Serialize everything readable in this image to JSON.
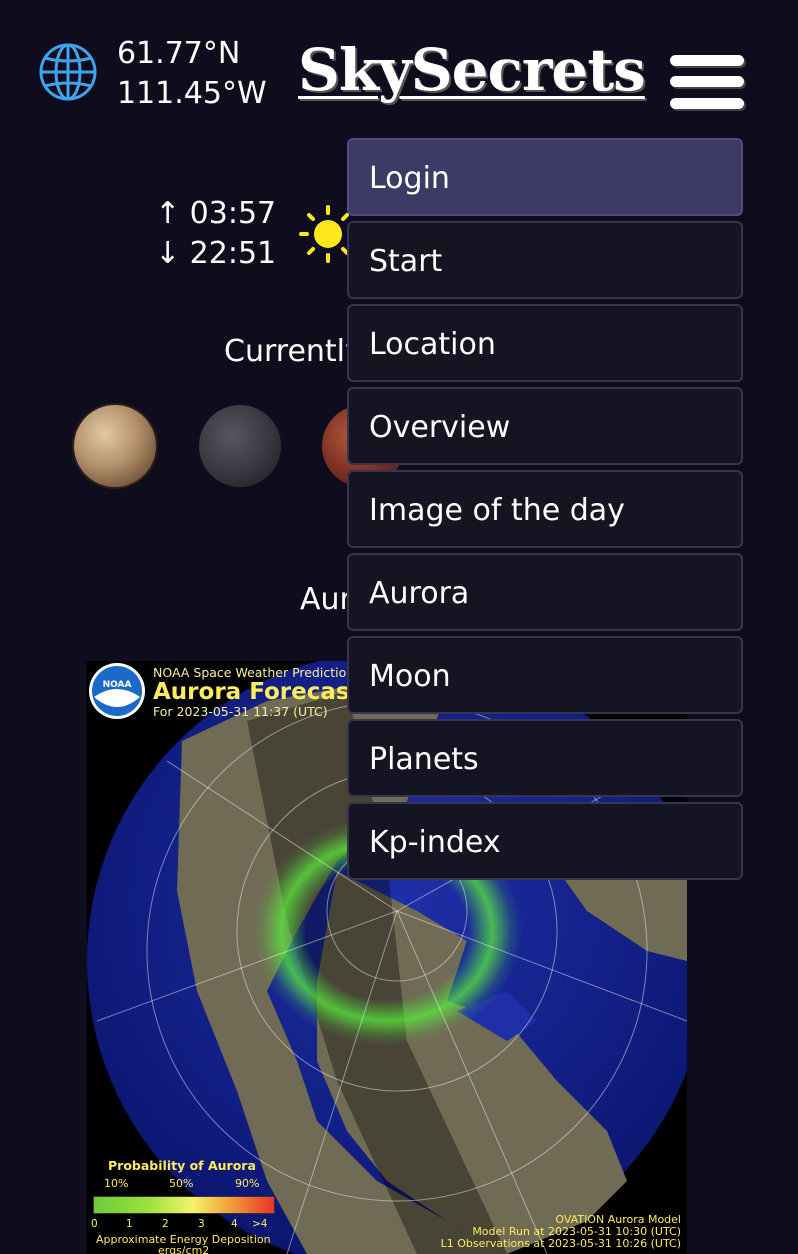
{
  "header": {
    "latitude": "61.77°N",
    "longitude": "111.45°W",
    "brand": "SkySecrets"
  },
  "sun": {
    "rise": "↑ 03:57",
    "set": "↓ 22:51"
  },
  "planets": {
    "heading": "Currently"
  },
  "aurora": {
    "heading": "Aur",
    "map": {
      "source": "NOAA Space Weather Predictio",
      "title": "Aurora Forecas",
      "for_time": "For 2023-05-31 11:37 (UTC)",
      "logo_text": "NOAA",
      "probability_title": "Probability of Aurora",
      "probability_labels": [
        "10%",
        "50%",
        "90%"
      ],
      "scale_labels": [
        "0",
        "1",
        "2",
        "3",
        "4",
        ">4"
      ],
      "energy_label": "Approximate Energy Deposition",
      "energy_unit": "ergs/cm2",
      "model_name": "OVATION Aurora Model",
      "model_run": "Model Run at 2023-05-31 10:30 (UTC)",
      "observations": "L1 Observations at 2023-05-31 10:26 (UTC)"
    }
  },
  "menu": {
    "items": [
      {
        "label": "Login"
      },
      {
        "label": "Start"
      },
      {
        "label": "Location"
      },
      {
        "label": "Overview"
      },
      {
        "label": "Image of the day"
      },
      {
        "label": "Aurora"
      },
      {
        "label": "Moon"
      },
      {
        "label": "Planets"
      },
      {
        "label": "Kp-index"
      }
    ],
    "active_index": 0
  },
  "colors": {
    "background": "#0f0d1d",
    "menu_item": "#151423",
    "menu_active": "#3e3a66",
    "globe_icon": "#3fa4ee",
    "sun_icon": "#ffe81c"
  }
}
